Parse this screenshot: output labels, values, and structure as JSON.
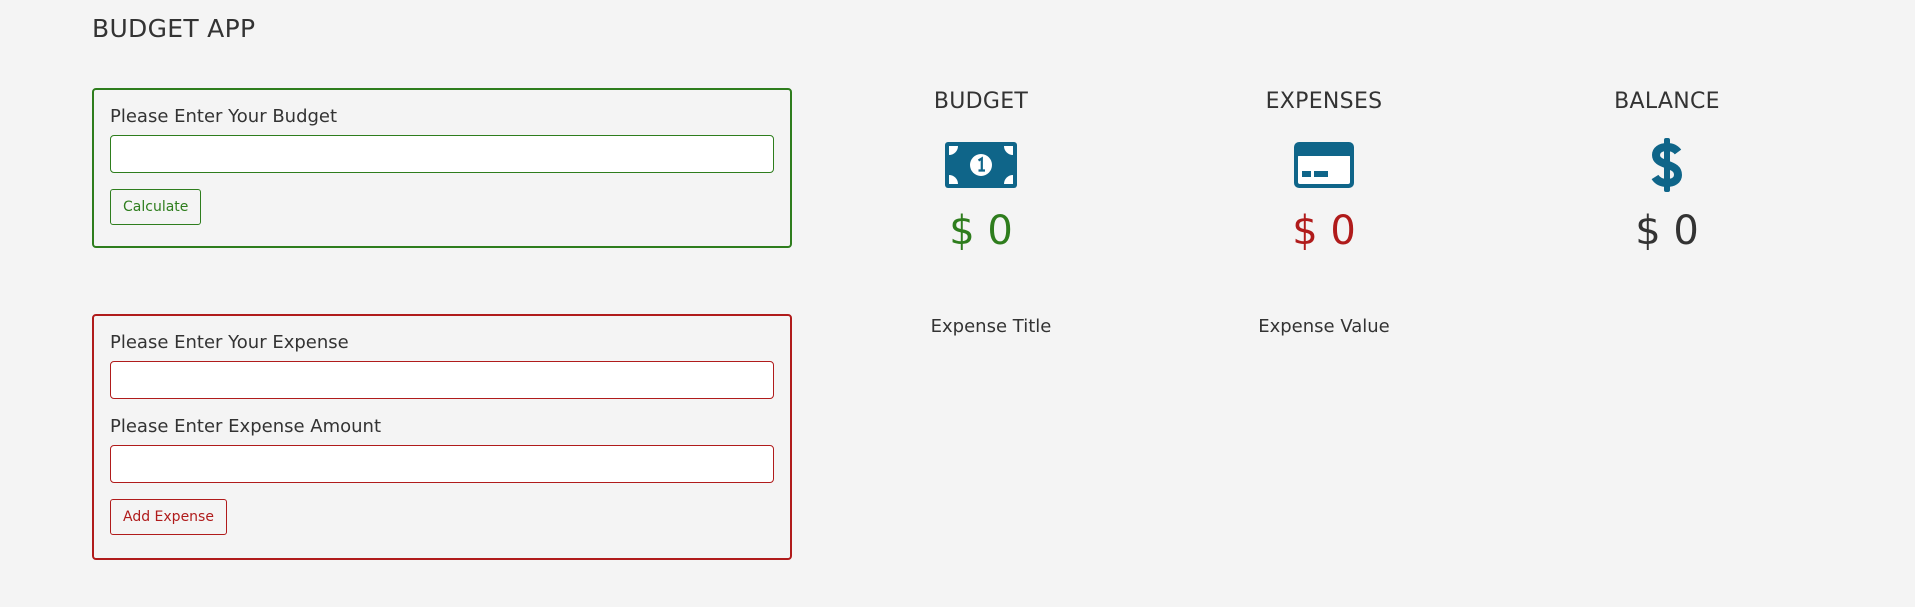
{
  "app": {
    "title": "BUDGET APP"
  },
  "budget_form": {
    "label": "Please Enter Your Budget",
    "value": "",
    "button_label": "Calculate"
  },
  "expense_form": {
    "title_label": "Please Enter Your Expense",
    "title_value": "",
    "amount_label": "Please Enter Expense Amount",
    "amount_value": "",
    "button_label": "Add Expense"
  },
  "summary": {
    "budget": {
      "heading": "BUDGET",
      "icon": "money-bill-icon",
      "amount": "$ 0",
      "color": "#2e7d1d"
    },
    "expenses": {
      "heading": "EXPENSES",
      "icon": "credit-card-icon",
      "amount": "$ 0",
      "color": "#b01b1b"
    },
    "balance": {
      "heading": "BALANCE",
      "icon": "dollar-sign-icon",
      "amount": "$ 0",
      "color": "#333333"
    }
  },
  "expense_list": {
    "title_header": "Expense Title",
    "value_header": "Expense Value"
  },
  "colors": {
    "icon": "#0f6589",
    "budget_accent": "#2e7d1d",
    "expense_accent": "#b01b1b",
    "background": "#f4f4f4"
  }
}
